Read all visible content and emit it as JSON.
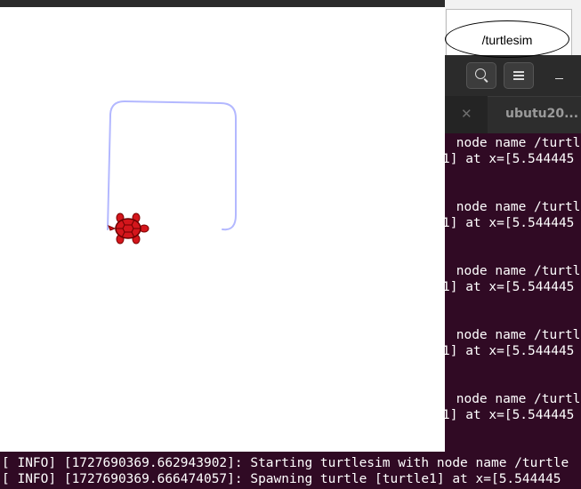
{
  "graph_window": {
    "node_label": "/turtlesim"
  },
  "terminal": {
    "tab_title": "ubutu20...",
    "tab_close_icon": "close-icon",
    "lines": [
      " node name /turtle",
      "1] at x=[5.544445",
      " node name /turtle",
      "1] at x=[5.544445",
      " node name /turtle",
      "1] at x=[5.544445",
      " node name /turtle",
      "1] at x=[5.544445",
      " node name /turtle",
      "1] at x=[5.544445",
      "[ INFO] [1727690369.662943902]: Starting turtlesim with node name /turtle",
      "[ INFO] [1727690369.666474057]: Spawning turtle [turtle1] at x=[5.544445"
    ],
    "colors": {
      "background": "#300a24",
      "text": "#ffffff"
    }
  },
  "turtlesim": {
    "background": "#ffffff",
    "pen_color": "#b3b8ff",
    "turtle_color": "#d4161c",
    "icons": [
      "turtle-icon"
    ]
  }
}
